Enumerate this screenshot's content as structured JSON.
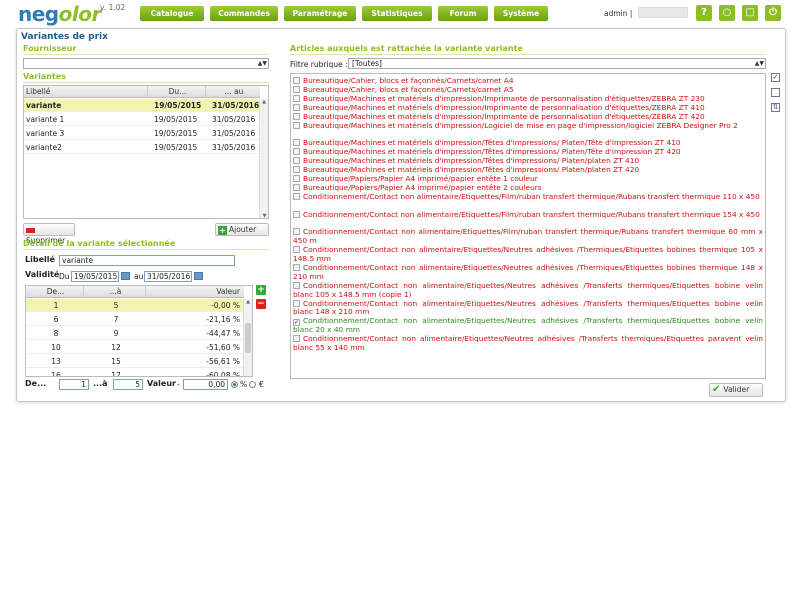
{
  "app": {
    "logo_part1": "neg",
    "logo_part2": "olor",
    "version": "v. 1.02",
    "user": "admin |"
  },
  "nav": [
    "Catalogue",
    "Commandes",
    "Paramétrage",
    "Statistiques",
    "Forum",
    "Système"
  ],
  "top_icons": [
    "help-icon",
    "lock-icon",
    "window-icon",
    "power-icon"
  ],
  "page_title": "Variantes de prix",
  "fournisseur": {
    "title": "Fournisseur",
    "value": ""
  },
  "variantes": {
    "title": "Variantes",
    "columns": [
      "Libellé",
      "Du...",
      "... au"
    ],
    "rows": [
      {
        "libelle": "variante",
        "du": "19/05/2015",
        "au": "31/05/2016",
        "selected": true
      },
      {
        "libelle": "variante 1",
        "du": "19/05/2015",
        "au": "31/05/2016",
        "selected": false
      },
      {
        "libelle": "variante 3",
        "du": "19/05/2015",
        "au": "31/05/2016",
        "selected": false
      },
      {
        "libelle": "variante2",
        "du": "19/05/2015",
        "au": "31/05/2016",
        "selected": false
      }
    ],
    "delete_label": "Supprimer",
    "add_label": "Ajouter"
  },
  "detail": {
    "title": "Détail de la variante sélectionnée",
    "libelle_label": "Libellé",
    "libelle_value": "variante",
    "validite_label": "Validité",
    "du_label": "Du",
    "du_value": "19/05/2015",
    "au_label": "au",
    "au_value": "31/05/2016",
    "columns": [
      "De...",
      "...à",
      "Valeur"
    ],
    "rows": [
      {
        "de": "1",
        "a": "5",
        "valeur": "-0,00 %",
        "selected": true
      },
      {
        "de": "6",
        "a": "7",
        "valeur": "-21,16 %",
        "selected": false
      },
      {
        "de": "8",
        "a": "9",
        "valeur": "-44,47 %",
        "selected": false
      },
      {
        "de": "10",
        "a": "12",
        "valeur": "-51,60 %",
        "selected": false
      },
      {
        "de": "13",
        "a": "15",
        "valeur": "-56,61 %",
        "selected": false
      },
      {
        "de": "16",
        "a": "17",
        "valeur": "-60,08 %",
        "selected": false
      }
    ],
    "footer": {
      "de_label": "De...",
      "de_value": "1",
      "a_label": "...à",
      "a_value": "5",
      "valeur_label": "Valeur",
      "sign": "-",
      "valeur_value": "0,00",
      "percent_label": "%",
      "euro_label": "€",
      "percent_selected": true
    }
  },
  "articles": {
    "title": "Articles auxquels est rattachée la variante variante",
    "filter_label": "Filtre rubrique :",
    "filter_value": "[Toutes]",
    "items": [
      {
        "text": "Bureautique/Cahier, blocs et façonnés/Carnets/carnet A4",
        "checked": false
      },
      {
        "text": "Bureautique/Cahier, blocs et façonnés/Carnets/carnet A5",
        "checked": false
      },
      {
        "text": "Bureautique/Machines et matériels d'impression/Imprimante de personnalisation d'étiquettes/ZEBRA ZT 230",
        "checked": false
      },
      {
        "text": "Bureautique/Machines et matériels d'impression/Imprimante de personnalisation d'étiquettes/ZEBRA ZT 410",
        "checked": false
      },
      {
        "text": "Bureautique/Machines et matériels d'impression/Imprimante de personnalisation d'étiquettes/ZEBRA ZT 420",
        "checked": false
      },
      {
        "text": "Bureautique/Machines et matériels d'impression/Logiciel de mise en page d'impression/logiciel ZEBRA Designer Pro 2",
        "checked": false
      },
      {
        "text": "Bureautique/Machines et matériels d'impression/Têtes d'impressions/ Platen/Tête d'impression ZT 410",
        "checked": false
      },
      {
        "text": "Bureautique/Machines et matériels d'impression/Têtes d'impressions/ Platen/Tête d'impression ZT 420",
        "checked": false
      },
      {
        "text": "Bureautique/Machines et matériels d'impression/Têtes d'impressions/ Platen/platen ZT 410",
        "checked": false
      },
      {
        "text": "Bureautique/Machines et matériels d'impression/Têtes d'impressions/ Platen/platen ZT 420",
        "checked": false
      },
      {
        "text": "Bureautique/Papiers/Papier A4 imprimé/papier entête 1 couleur",
        "checked": false
      },
      {
        "text": "Bureautique/Papiers/Papier A4 imprimé/papier entête 2 couleurs",
        "checked": false
      },
      {
        "text": "Conditionnement/Contact non alimentaire/Etiquettes/Film/ruban transfert thermique/Rubans transfert thermique 110 x 450",
        "checked": false
      },
      {
        "text": "Conditionnement/Contact non alimentaire/Etiquettes/Film/ruban transfert thermique/Rubans transfert thermique 154 x 450",
        "checked": false
      },
      {
        "text": "Conditionnement/Contact non alimentaire/Etiquettes/Film/ruban transfert thermique/Rubans transfert thermique 60 mm x 450 m",
        "checked": false
      },
      {
        "text": "Conditionnement/Contact non alimentaire/Etiquettes/Neutres adhésives /Thermiques/Etiquettes bobines thermique 105 x 148.5 mm",
        "checked": false
      },
      {
        "text": "Conditionnement/Contact non alimentaire/Etiquettes/Neutres adhésives /Thermiques/Etiquettes bobines thermique 148 x 210 mm",
        "checked": false
      },
      {
        "text": "Conditionnement/Contact non alimentaire/Etiquettes/Neutres adhésives /Transferts thermiques/Etiquettes bobine velin blanc 105 x 148.5 mm (copie 1)",
        "checked": false
      },
      {
        "text": "Conditionnement/Contact non alimentaire/Etiquettes/Neutres adhésives /Transferts thermiques/Etiquettes bobine velin blanc 148 x 210 mm",
        "checked": false
      },
      {
        "text": "Conditionnement/Contact non alimentaire/Etiquettes/Neutres adhésives /Transferts thermiques/Etiquettes bobine velin blanc 20 x 40 mm",
        "checked": true
      },
      {
        "text": "Conditionnement/Contact non alimentaire/Etiquettes/Neutres adhésives /Transferts thermiques/Etiquettes paravent velin blanc 55 x 140 mm",
        "checked": false
      }
    ],
    "validate_label": "Valider"
  },
  "colors": {
    "accent_green": "#8cbf26",
    "title_blue": "#1a5e8a",
    "unchecked_red": "#cc1111",
    "checked_green": "#2c8a1e",
    "selected_row": "#f3f3b0"
  }
}
